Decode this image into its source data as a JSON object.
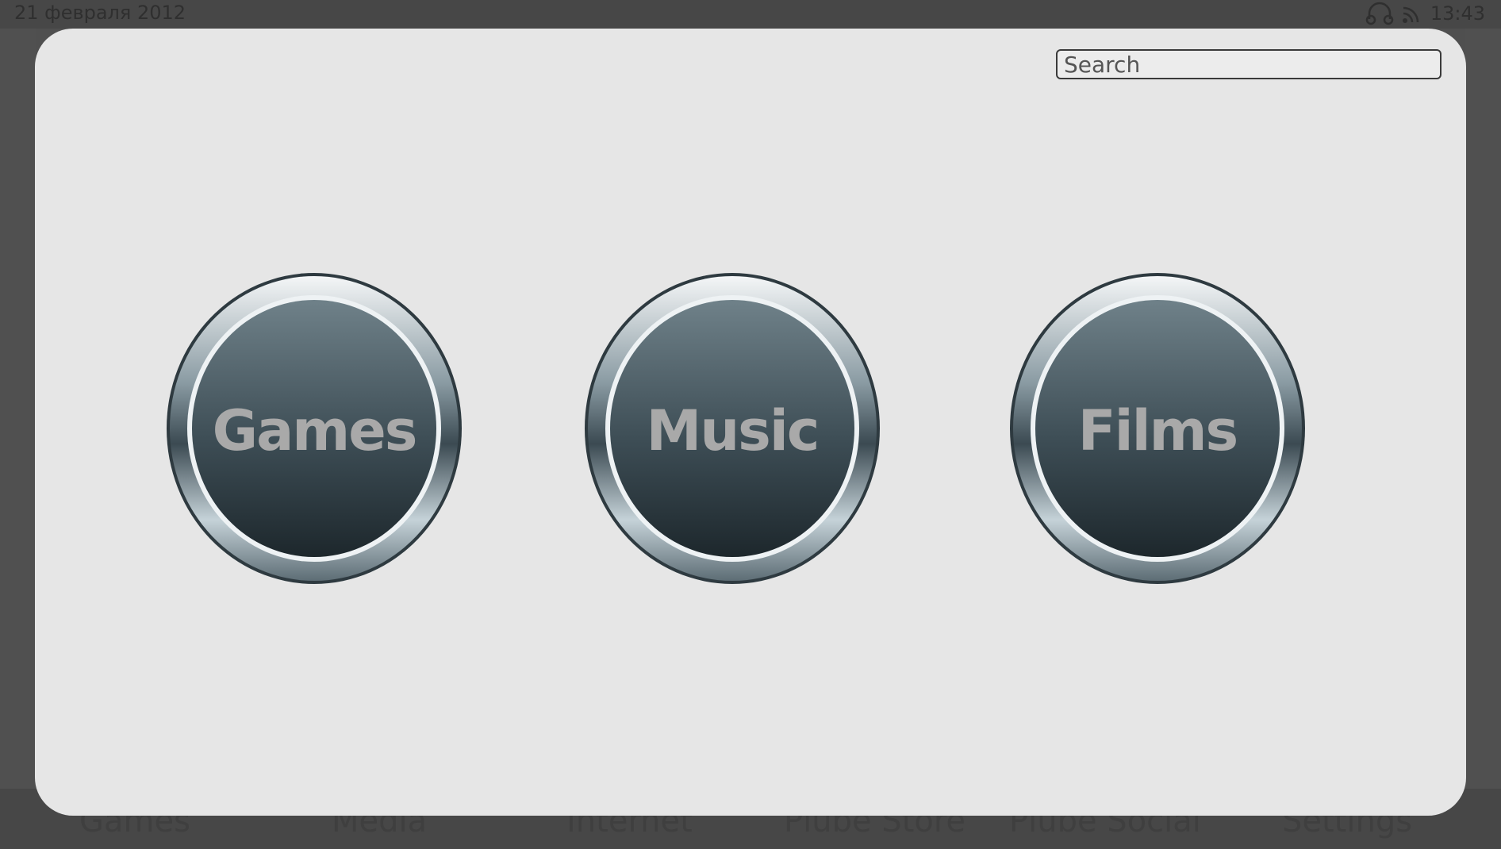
{
  "status_bar": {
    "date": "21 февраля 2012",
    "time": "13:43",
    "icons": [
      "headphones-icon",
      "wifi-icon"
    ]
  },
  "search": {
    "placeholder": "Search",
    "value": ""
  },
  "buttons": [
    {
      "label": "Games"
    },
    {
      "label": "Music"
    },
    {
      "label": "Films"
    }
  ],
  "dock": {
    "items": [
      {
        "label": "Games"
      },
      {
        "label": "Media"
      },
      {
        "label": "Internet"
      },
      {
        "label": "Plube Store"
      },
      {
        "label": "Plube Social"
      },
      {
        "label": "Settings"
      }
    ]
  },
  "colors": {
    "background": "#474747",
    "panel": "#e6e6e6",
    "button_face_top": "#6e7f87",
    "button_face_bottom": "#1f2a30",
    "button_label": "#a9a9a9"
  }
}
